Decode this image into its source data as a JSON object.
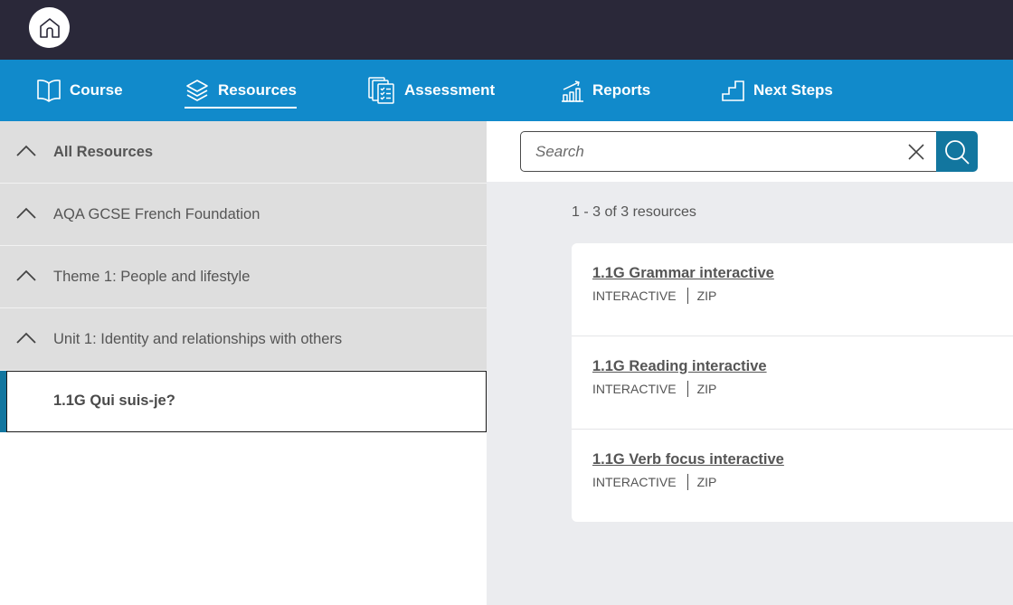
{
  "topbar": {
    "home_icon": "home-icon"
  },
  "nav": {
    "items": [
      {
        "label": "Course",
        "icon": "open-book-icon",
        "active": false
      },
      {
        "label": "Resources",
        "icon": "layers-icon",
        "active": true
      },
      {
        "label": "Assessment",
        "icon": "checklist-documents-icon",
        "active": false
      },
      {
        "label": "Reports",
        "icon": "bar-chart-trend-icon",
        "active": false
      },
      {
        "label": "Next Steps",
        "icon": "stairs-icon",
        "active": false
      }
    ]
  },
  "sidebar": {
    "tree": [
      {
        "label": "All Resources",
        "icon": "chevron-up-icon",
        "bold": true
      },
      {
        "label": "AQA GCSE French Foundation",
        "icon": "chevron-up-icon",
        "bold": false
      },
      {
        "label": "Theme 1: People and lifestyle",
        "icon": "chevron-up-icon",
        "bold": false
      },
      {
        "label": "Unit 1: Identity and relationships with others",
        "icon": "chevron-up-icon",
        "bold": false
      }
    ],
    "selected": {
      "label": "1.1G Qui suis-je?"
    }
  },
  "search": {
    "placeholder": "Search",
    "value": "",
    "clear_icon": "close-icon",
    "submit_icon": "search-icon"
  },
  "results": {
    "count_text": "1 - 3 of 3 resources",
    "items": [
      {
        "title": "1.1G Grammar interactive",
        "type": "INTERACTIVE",
        "format": "ZIP"
      },
      {
        "title": "1.1G Reading interactive",
        "type": "INTERACTIVE",
        "format": "ZIP"
      },
      {
        "title": "1.1G Verb focus interactive",
        "type": "INTERACTIVE",
        "format": "ZIP"
      }
    ]
  },
  "colors": {
    "topbar": "#2a2839",
    "navbar": "#118acb",
    "accent": "#12769f",
    "sidebar_row": "#dedede",
    "main_bg": "#ebecef"
  }
}
